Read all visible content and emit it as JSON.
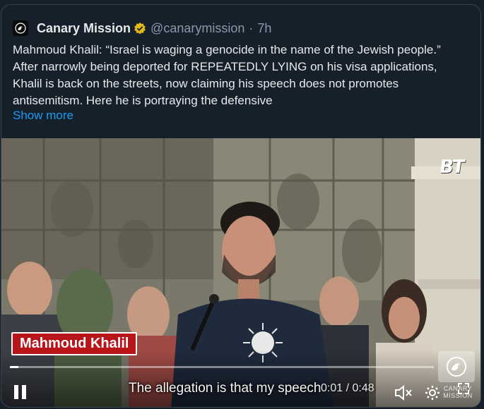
{
  "post": {
    "author_name": "Canary Mission",
    "handle": "@canarymission",
    "separator": "·",
    "time_ago": "7h",
    "text": "Mahmoud Khalil: “Israel is waging a genocide in the name of the Jewish people.” After narrowly being deported for REPEATEDLY LYING on his visa applications, Khalil is back on the streets, now claiming his speech does not promotes antisemitism. Here he is portraying the defensive",
    "show_more": "Show more"
  },
  "video": {
    "channel_logo": "BT",
    "name_tag": "Mahmoud Khalil",
    "caption": "The allegation is that my speech",
    "time_display": "0:01 / 0:48",
    "progress": 0.02,
    "watermark_text": "CANARY MISSION"
  },
  "icons": {
    "verified": "verified-badge-icon",
    "pause": "pause-icon",
    "mute": "mute-icon",
    "settings": "gear-icon",
    "fullscreen": "fullscreen-icon"
  },
  "colors": {
    "background": "#15202b",
    "link": "#1d9bf0",
    "verified_gold": "#e2b719",
    "name_tag_red": "#b8151b"
  }
}
